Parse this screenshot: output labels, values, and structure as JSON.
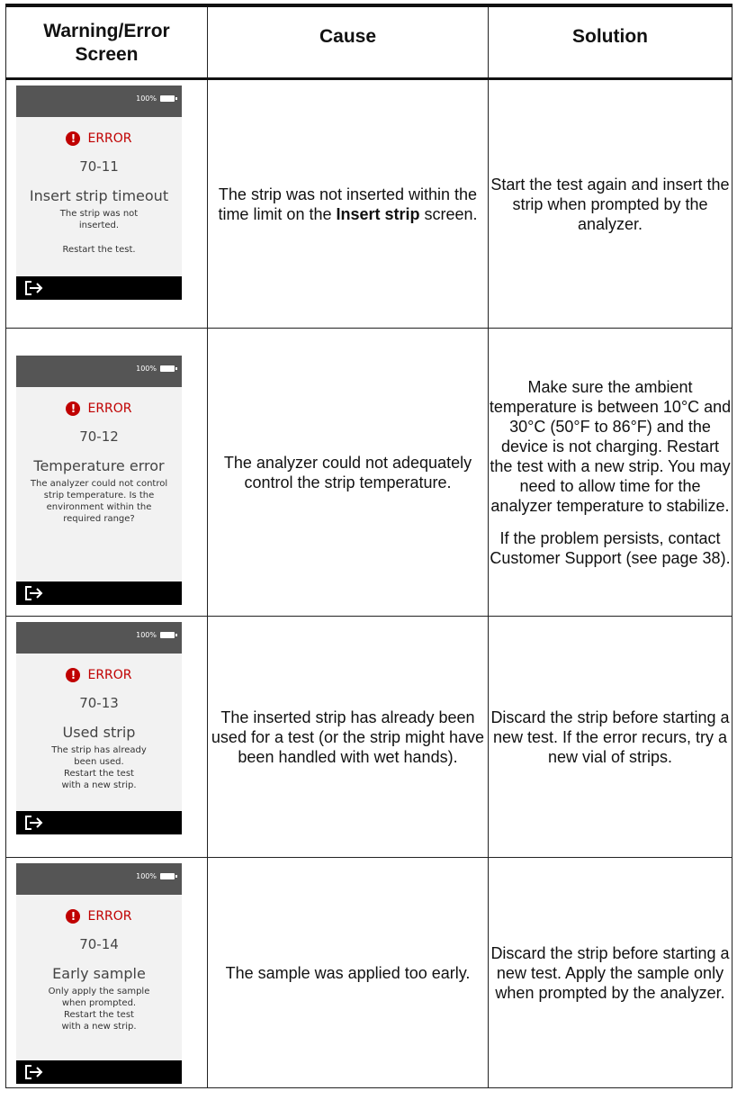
{
  "headers": {
    "screen": "Warning/Error Screen",
    "cause": "Cause",
    "solution": "Solution"
  },
  "device": {
    "battery": "100%",
    "error_label": "ERROR",
    "error_icon": "exclamation-circle-icon",
    "exit_icon": "exit-arrow-icon"
  },
  "rows": [
    {
      "code": "70-11",
      "title": "Insert strip timeout",
      "message": "The strip was not inserted.",
      "message2": "Restart the test.",
      "cause_pre": "The strip was not inserted within the time limit on the ",
      "cause_bold": "Insert strip",
      "cause_post": " screen.",
      "solution": [
        "Start the test again and insert the strip when prompted by the analyzer."
      ]
    },
    {
      "code": "70-12",
      "title": "Temperature error",
      "message": "The analyzer could not control strip temperature. Is the environment within the required range?",
      "message2": "",
      "cause": "The analyzer could not adequately control the strip temperature.",
      "solution": [
        "Make sure the ambient temperature is between 10°C and 30°C (50°F to 86°F) and the device is not charging. Restart the test with a new strip. You may need to allow time for the analyzer temperature to stabilize.",
        "If the problem persists, contact Customer Support (see page 38)."
      ]
    },
    {
      "code": "70-13",
      "title": "Used strip",
      "message": "The strip has already been used.",
      "message2": "Restart the test with a new strip.",
      "cause": "The inserted strip has already been used for a test (or the strip might have been handled with wet hands).",
      "solution": [
        "Discard the strip before starting a new test. If the error recurs, try a new vial of strips."
      ]
    },
    {
      "code": "70-14",
      "title": "Early sample",
      "message": "Only apply the sample when prompted.",
      "message2": "Restart the test with a new strip.",
      "cause": "The sample was applied too early.",
      "solution": [
        "Discard the strip before starting a new test. Apply the sample only when prompted by the analyzer."
      ]
    }
  ]
}
